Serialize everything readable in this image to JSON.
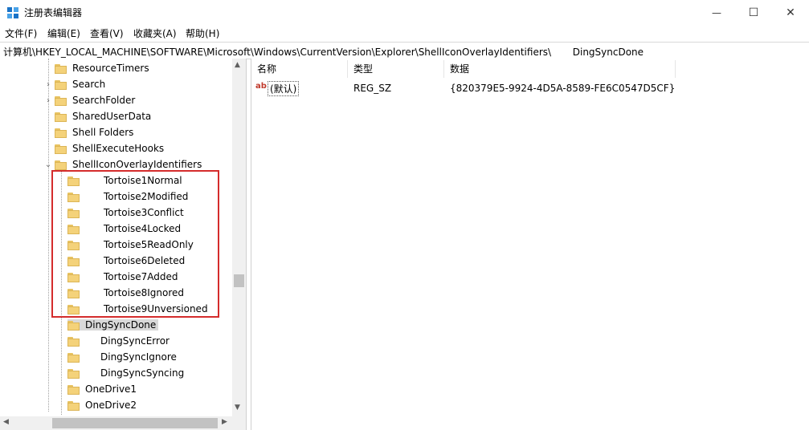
{
  "window": {
    "title": "注册表编辑器",
    "minimize_glyph": "—",
    "maximize_glyph": "☐",
    "close_glyph": "✕"
  },
  "menu": [
    "文件(F)",
    "编辑(E)",
    "查看(V)",
    "收藏夹(A)",
    "帮助(H)"
  ],
  "address": "计算机\\HKEY_LOCAL_MACHINE\\SOFTWARE\\Microsoft\\Windows\\CurrentVersion\\Explorer\\ShellIconOverlayIdentifiers\\       DingSyncDone",
  "tree": {
    "items": [
      "ResourceTimers",
      "Search",
      "SearchFolder",
      "SharedUserData",
      "Shell Folders",
      "ShellExecuteHooks",
      "ShellIconOverlayIdentifiers",
      "Tortoise1Normal",
      "Tortoise2Modified",
      "Tortoise3Conflict",
      "Tortoise4Locked",
      "Tortoise5ReadOnly",
      "Tortoise6Deleted",
      "Tortoise7Added",
      "Tortoise8Ignored",
      "Tortoise9Unversioned",
      "DingSyncDone",
      "DingSyncError",
      "DingSyncIgnore",
      "DingSyncSyncing",
      "OneDrive1",
      "OneDrive2"
    ],
    "selected": "DingSyncDone",
    "icon": "folder-icon"
  },
  "list": {
    "columns": [
      "名称",
      "类型",
      "数据"
    ],
    "rows": [
      {
        "name": "(默认)",
        "type": "REG_SZ",
        "data": "{820379E5-9924-4D5A-8589-FE6C0547D5CF}",
        "icon": "string-value-icon"
      }
    ]
  },
  "colors": {
    "highlight_border": "#d42c2c",
    "selection_bg": "#d9d9d9",
    "folder": "#f4d27a"
  }
}
